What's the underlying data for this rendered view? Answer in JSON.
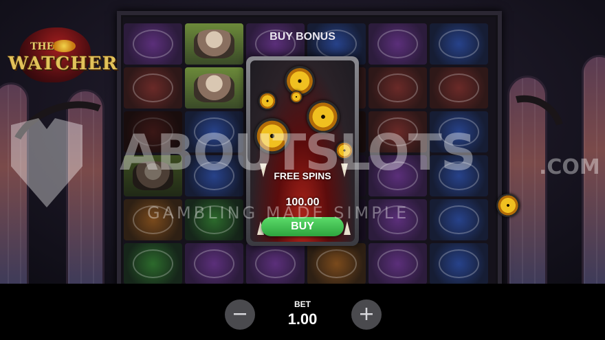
{
  "game": {
    "logo_the": "THE",
    "logo_name": "WATCHER"
  },
  "buy_bonus": {
    "title": "BUY BONUS",
    "option_label": "FREE SPINS",
    "price": "100.00",
    "buy_label": "BUY"
  },
  "watermark": {
    "main": "ABOUTSLOTS",
    "suffix": ".COM",
    "tagline": "GAMBLING MADE SIMPLE"
  },
  "bet": {
    "label": "BET",
    "value": "1.00",
    "decrease_icon": "minus-icon",
    "increase_icon": "plus-icon"
  },
  "colors": {
    "buy_button": "#3cbc4c",
    "bet_button": "#4a4a4e",
    "bottom_bar": "#000000"
  }
}
